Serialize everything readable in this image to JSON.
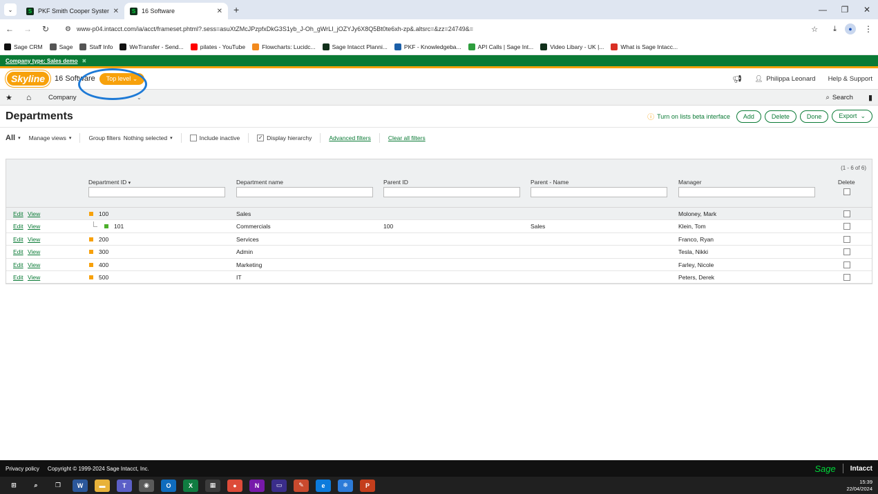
{
  "browser": {
    "tabs": [
      {
        "title": "PKF Smith Cooper Systems",
        "active": false
      },
      {
        "title": "16 Software",
        "active": true
      }
    ],
    "new_tab": "+",
    "url": "www-p04.intacct.com/ia/acct/frameset.phtml?.sess=asuXtZMcJPzpfxDkG3S1yb_J-Oh_gWrLI_jOZYJy6X8Q5Bt0te6xh-zp&.altsrc=&zz=24749&=",
    "bookmarks": [
      {
        "label": "Sage CRM",
        "icon": "sage-crm-icon",
        "color": "#111111"
      },
      {
        "label": "Sage",
        "icon": "folder-icon",
        "color": "#555555"
      },
      {
        "label": "Staff Info",
        "icon": "folder-icon",
        "color": "#555555"
      },
      {
        "label": "WeTransfer - Send...",
        "icon": "wetransfer-icon",
        "color": "#111111"
      },
      {
        "label": "pilates - YouTube",
        "icon": "youtube-icon",
        "color": "#ff0000"
      },
      {
        "label": "Flowcharts: Lucidc...",
        "icon": "lucid-icon",
        "color": "#f28a1e"
      },
      {
        "label": "Sage Intacct Planni...",
        "icon": "sage-icon",
        "color": "#11301b"
      },
      {
        "label": "PKF - Knowledgeba...",
        "icon": "pkf-icon",
        "color": "#1b5fa8"
      },
      {
        "label": "API Calls | Sage Int...",
        "icon": "api-icon",
        "color": "#2e9e3e"
      },
      {
        "label": "Video Libary - UK |...",
        "icon": "sage-icon",
        "color": "#11301b"
      },
      {
        "label": "What is Sage Intacc...",
        "icon": "gmail-icon",
        "color": "#d93025"
      }
    ]
  },
  "banner": {
    "text": "Company type: Sales demo",
    "close": "✖"
  },
  "header": {
    "logo": "Skyline",
    "entity": "16 Software",
    "level": "Top level",
    "user": "Philippa Leonard",
    "help": "Help & Support"
  },
  "nav": {
    "company": "Company",
    "search": "Search"
  },
  "page": {
    "title": "Departments",
    "beta_link": "Turn on lists beta interface",
    "buttons": {
      "add": "Add",
      "delete": "Delete",
      "done": "Done",
      "export": "Export"
    }
  },
  "filters": {
    "all": "All",
    "manage_views": "Manage views",
    "group_filters": "Group filters",
    "group_value": "Nothing selected",
    "include_inactive": "Include inactive",
    "include_inactive_checked": false,
    "display_hierarchy": "Display hierarchy",
    "display_hierarchy_checked": true,
    "advanced": "Advanced filters",
    "clear": "Clear all filters"
  },
  "grid": {
    "count": "(1 - 6 of 6)",
    "columns": {
      "id": "Department ID",
      "name": "Department name",
      "parent_id": "Parent ID",
      "parent_name": "Parent - Name",
      "manager": "Manager",
      "delete": "Delete"
    },
    "actions": {
      "edit": "Edit",
      "view": "View"
    },
    "rows": [
      {
        "id": "100",
        "name": "Sales",
        "parent_id": "",
        "parent_name": "",
        "manager": "Moloney, Mark",
        "child": false
      },
      {
        "id": "101",
        "name": "Commercials",
        "parent_id": "100",
        "parent_name": "Sales",
        "manager": "Klein, Tom",
        "child": true
      },
      {
        "id": "200",
        "name": "Services",
        "parent_id": "",
        "parent_name": "",
        "manager": "Franco, Ryan",
        "child": false
      },
      {
        "id": "300",
        "name": "Admin",
        "parent_id": "",
        "parent_name": "",
        "manager": "Tesla, Nikki",
        "child": false
      },
      {
        "id": "400",
        "name": "Marketing",
        "parent_id": "",
        "parent_name": "",
        "manager": "Farley, Nicole",
        "child": false
      },
      {
        "id": "500",
        "name": "IT",
        "parent_id": "",
        "parent_name": "",
        "manager": "Peters, Derek",
        "child": false
      }
    ]
  },
  "footer": {
    "privacy": "Privacy policy",
    "copyright": "Copyright © 1999-2024 Sage Intacct, Inc.",
    "sage": "Sage",
    "intacct": "Intacct"
  },
  "taskbar": {
    "time": "15:39",
    "date": "22/04/2024",
    "apps": [
      {
        "name": "windows-start-icon",
        "color": "#202020",
        "glyph": "⊞"
      },
      {
        "name": "search-icon",
        "color": "#202020",
        "glyph": "⌕"
      },
      {
        "name": "task-view-icon",
        "color": "#202020",
        "glyph": "❐"
      },
      {
        "name": "word-icon",
        "color": "#2b579a",
        "glyph": "W"
      },
      {
        "name": "file-explorer-icon",
        "color": "#e8b23a",
        "glyph": "▬"
      },
      {
        "name": "teams-icon",
        "color": "#5b5fc7",
        "glyph": "T"
      },
      {
        "name": "camera-icon",
        "color": "#5a5a5a",
        "glyph": "◉"
      },
      {
        "name": "outlook-icon",
        "color": "#0f6cbd",
        "glyph": "O"
      },
      {
        "name": "excel-icon",
        "color": "#107c41",
        "glyph": "X"
      },
      {
        "name": "calculator-icon",
        "color": "#3b3b3b",
        "glyph": "▦"
      },
      {
        "name": "chrome-icon",
        "color": "#dd4b39",
        "glyph": "●"
      },
      {
        "name": "onenote-icon",
        "color": "#7719aa",
        "glyph": "N"
      },
      {
        "name": "media-icon",
        "color": "#3a2d8a",
        "glyph": "▭"
      },
      {
        "name": "feather-icon",
        "color": "#c84a2e",
        "glyph": "✎"
      },
      {
        "name": "edge-icon",
        "color": "#0c7bdc",
        "glyph": "e"
      },
      {
        "name": "snowflake-icon",
        "color": "#2d7bd8",
        "glyph": "❄"
      },
      {
        "name": "powerpoint-icon",
        "color": "#c43e1c",
        "glyph": "P"
      }
    ]
  },
  "colors": {
    "brand_green": "#0a7a35",
    "brand_orange": "#f7a10b",
    "highlight_blue": "#1e7ad6",
    "dept_square": "#f7a10b",
    "child_square": "#4caf2b"
  }
}
